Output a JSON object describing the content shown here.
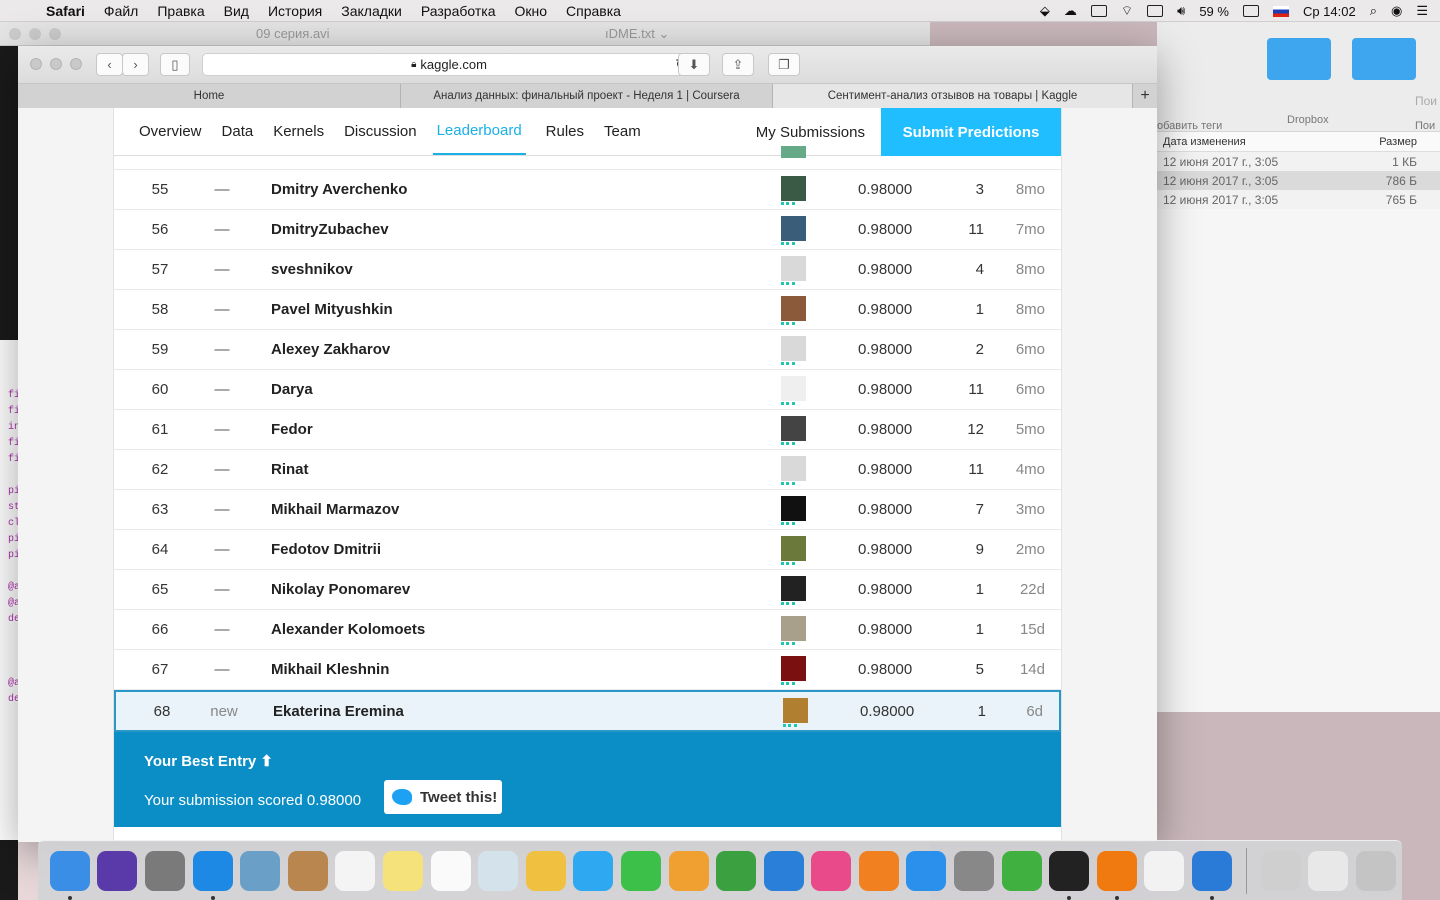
{
  "menubar": {
    "app": "Safari",
    "items": [
      "Файл",
      "Правка",
      "Вид",
      "История",
      "Закладки",
      "Разработка",
      "Окно",
      "Справка"
    ],
    "battery": "59 %",
    "clock": "Ср 14:02"
  },
  "background_window": {
    "title_left": "09 серия.avi",
    "title_right": "ıDME.txt ⌄"
  },
  "finder": {
    "tag_label": "обавить теги",
    "dropbox_label": "Dropbox",
    "search_placeholder": "Пои",
    "search_tail": "Пои",
    "col_date": "Дата изменения",
    "col_size": "Размер",
    "files": [
      {
        "date": "12 июня 2017 г., 3:05",
        "size": "1 КБ"
      },
      {
        "date": "12 июня 2017 г., 3:05",
        "size": "786 Б"
      },
      {
        "date": "12 июня 2017 г., 3:05",
        "size": "765 Б"
      }
    ]
  },
  "leftstrip": {
    "lines": [
      "fi",
      "fi",
      "in",
      "fi",
      "fi",
      "",
      "pi",
      "st",
      "cl",
      "pi",
      "pi",
      "",
      "@a",
      "@a",
      "de",
      "",
      "",
      "",
      "@a",
      "de"
    ]
  },
  "browser": {
    "url": "kaggle.com",
    "tabs": [
      {
        "label": "Home"
      },
      {
        "label": "Анализ данных: финальный проект - Неделя 1 | Coursera"
      },
      {
        "label": "Сентимент-анализ отзывов на товары | Kaggle"
      }
    ],
    "new_tab": "+"
  },
  "kaggle": {
    "nav": [
      "Overview",
      "Data",
      "Kernels",
      "Discussion",
      "Leaderboard",
      "Rules",
      "Team"
    ],
    "active_nav": "Leaderboard",
    "my_submissions": "My Submissions",
    "submit": "Submit Predictions",
    "rows": [
      {
        "rank": "55",
        "change": "—",
        "name": "Dmitry Averchenko",
        "score": "0.98000",
        "entries": "3",
        "last": "8mo",
        "avatar": "#3b5a45"
      },
      {
        "rank": "56",
        "change": "—",
        "name": "DmitryZubachev",
        "score": "0.98000",
        "entries": "11",
        "last": "7mo",
        "avatar": "#3a5e7a"
      },
      {
        "rank": "57",
        "change": "—",
        "name": "sveshnikov",
        "score": "0.98000",
        "entries": "4",
        "last": "8mo",
        "avatar": "#d9d9d9"
      },
      {
        "rank": "58",
        "change": "—",
        "name": "Pavel Mityushkin",
        "score": "0.98000",
        "entries": "1",
        "last": "8mo",
        "avatar": "#8a5a3a"
      },
      {
        "rank": "59",
        "change": "—",
        "name": "Alexey Zakharov",
        "score": "0.98000",
        "entries": "2",
        "last": "6mo",
        "avatar": "#d9d9d9"
      },
      {
        "rank": "60",
        "change": "—",
        "name": "Darya",
        "score": "0.98000",
        "entries": "11",
        "last": "6mo",
        "avatar": "#efefef"
      },
      {
        "rank": "61",
        "change": "—",
        "name": "Fedor",
        "score": "0.98000",
        "entries": "12",
        "last": "5mo",
        "avatar": "#444444"
      },
      {
        "rank": "62",
        "change": "—",
        "name": "Rinat",
        "score": "0.98000",
        "entries": "11",
        "last": "4mo",
        "avatar": "#d9d9d9"
      },
      {
        "rank": "63",
        "change": "—",
        "name": "Mikhail Marmazov",
        "score": "0.98000",
        "entries": "7",
        "last": "3mo",
        "avatar": "#111111"
      },
      {
        "rank": "64",
        "change": "—",
        "name": "Fedotov Dmitrii",
        "score": "0.98000",
        "entries": "9",
        "last": "2mo",
        "avatar": "#6b7a3a"
      },
      {
        "rank": "65",
        "change": "—",
        "name": "Nikolay Ponomarev",
        "score": "0.98000",
        "entries": "1",
        "last": "22d",
        "avatar": "#222222"
      },
      {
        "rank": "66",
        "change": "—",
        "name": "Alexander Kolomoets",
        "score": "0.98000",
        "entries": "1",
        "last": "15d",
        "avatar": "#a8a08a"
      },
      {
        "rank": "67",
        "change": "—",
        "name": "Mikhail Kleshnin",
        "score": "0.98000",
        "entries": "5",
        "last": "14d",
        "avatar": "#7a1010"
      }
    ],
    "me": {
      "rank": "68",
      "change": "new",
      "name": "Ekaterina Eremina",
      "score": "0.98000",
      "entries": "1",
      "last": "6d",
      "avatar": "#b08030"
    },
    "best": {
      "title": "Your Best Entry ⬆",
      "text": "Your submission scored 0.98000",
      "tweet": "Tweet this!"
    }
  },
  "dock": {
    "apps": [
      {
        "name": "finder-icon",
        "color": "#3a8ee6",
        "run": true
      },
      {
        "name": "siri-icon",
        "color": "#5a3aa8",
        "run": false
      },
      {
        "name": "launchpad-icon",
        "color": "#7a7a7a",
        "run": false
      },
      {
        "name": "safari-icon",
        "color": "#1e88e5",
        "run": true
      },
      {
        "name": "preview-icon",
        "color": "#6aa0c8",
        "run": false
      },
      {
        "name": "contacts-icon",
        "color": "#b8864e",
        "run": false
      },
      {
        "name": "calendar-icon",
        "color": "#f4f4f4",
        "run": false
      },
      {
        "name": "notes-icon",
        "color": "#f6e27a",
        "run": false
      },
      {
        "name": "reminders-icon",
        "color": "#fafafa",
        "run": false
      },
      {
        "name": "photo-booth-icon",
        "color": "#d4e2ec",
        "run": false
      },
      {
        "name": "photos-icon",
        "color": "#f0c040",
        "run": false
      },
      {
        "name": "messages-icon",
        "color": "#2ea8f0",
        "run": false
      },
      {
        "name": "facetime-icon",
        "color": "#3cc04a",
        "run": false
      },
      {
        "name": "pages-icon",
        "color": "#f0a030",
        "run": false
      },
      {
        "name": "numbers-icon",
        "color": "#3aa040",
        "run": false
      },
      {
        "name": "keynote-icon",
        "color": "#2a80d8",
        "run": false
      },
      {
        "name": "itunes-icon",
        "color": "#e84a8a",
        "run": false
      },
      {
        "name": "ibooks-icon",
        "color": "#f08020",
        "run": false
      },
      {
        "name": "app-store-icon",
        "color": "#2a90ec",
        "run": false
      },
      {
        "name": "system-preferences-icon",
        "color": "#888888",
        "run": false
      },
      {
        "name": "circle-app-icon",
        "color": "#40b040",
        "run": false
      },
      {
        "name": "terminal-icon",
        "color": "#222222",
        "run": true
      },
      {
        "name": "vlc-icon",
        "color": "#f07a10",
        "run": true
      },
      {
        "name": "textedit-icon",
        "color": "#f2f2f2",
        "run": false
      },
      {
        "name": "xcode-icon",
        "color": "#2a7ad8",
        "run": true
      }
    ],
    "right": [
      {
        "name": "help-icon",
        "color": "#cfcfcf"
      },
      {
        "name": "downloads-stack-icon",
        "color": "#e8e8e8"
      },
      {
        "name": "trash-icon",
        "color": "#c4c4c4"
      }
    ]
  }
}
